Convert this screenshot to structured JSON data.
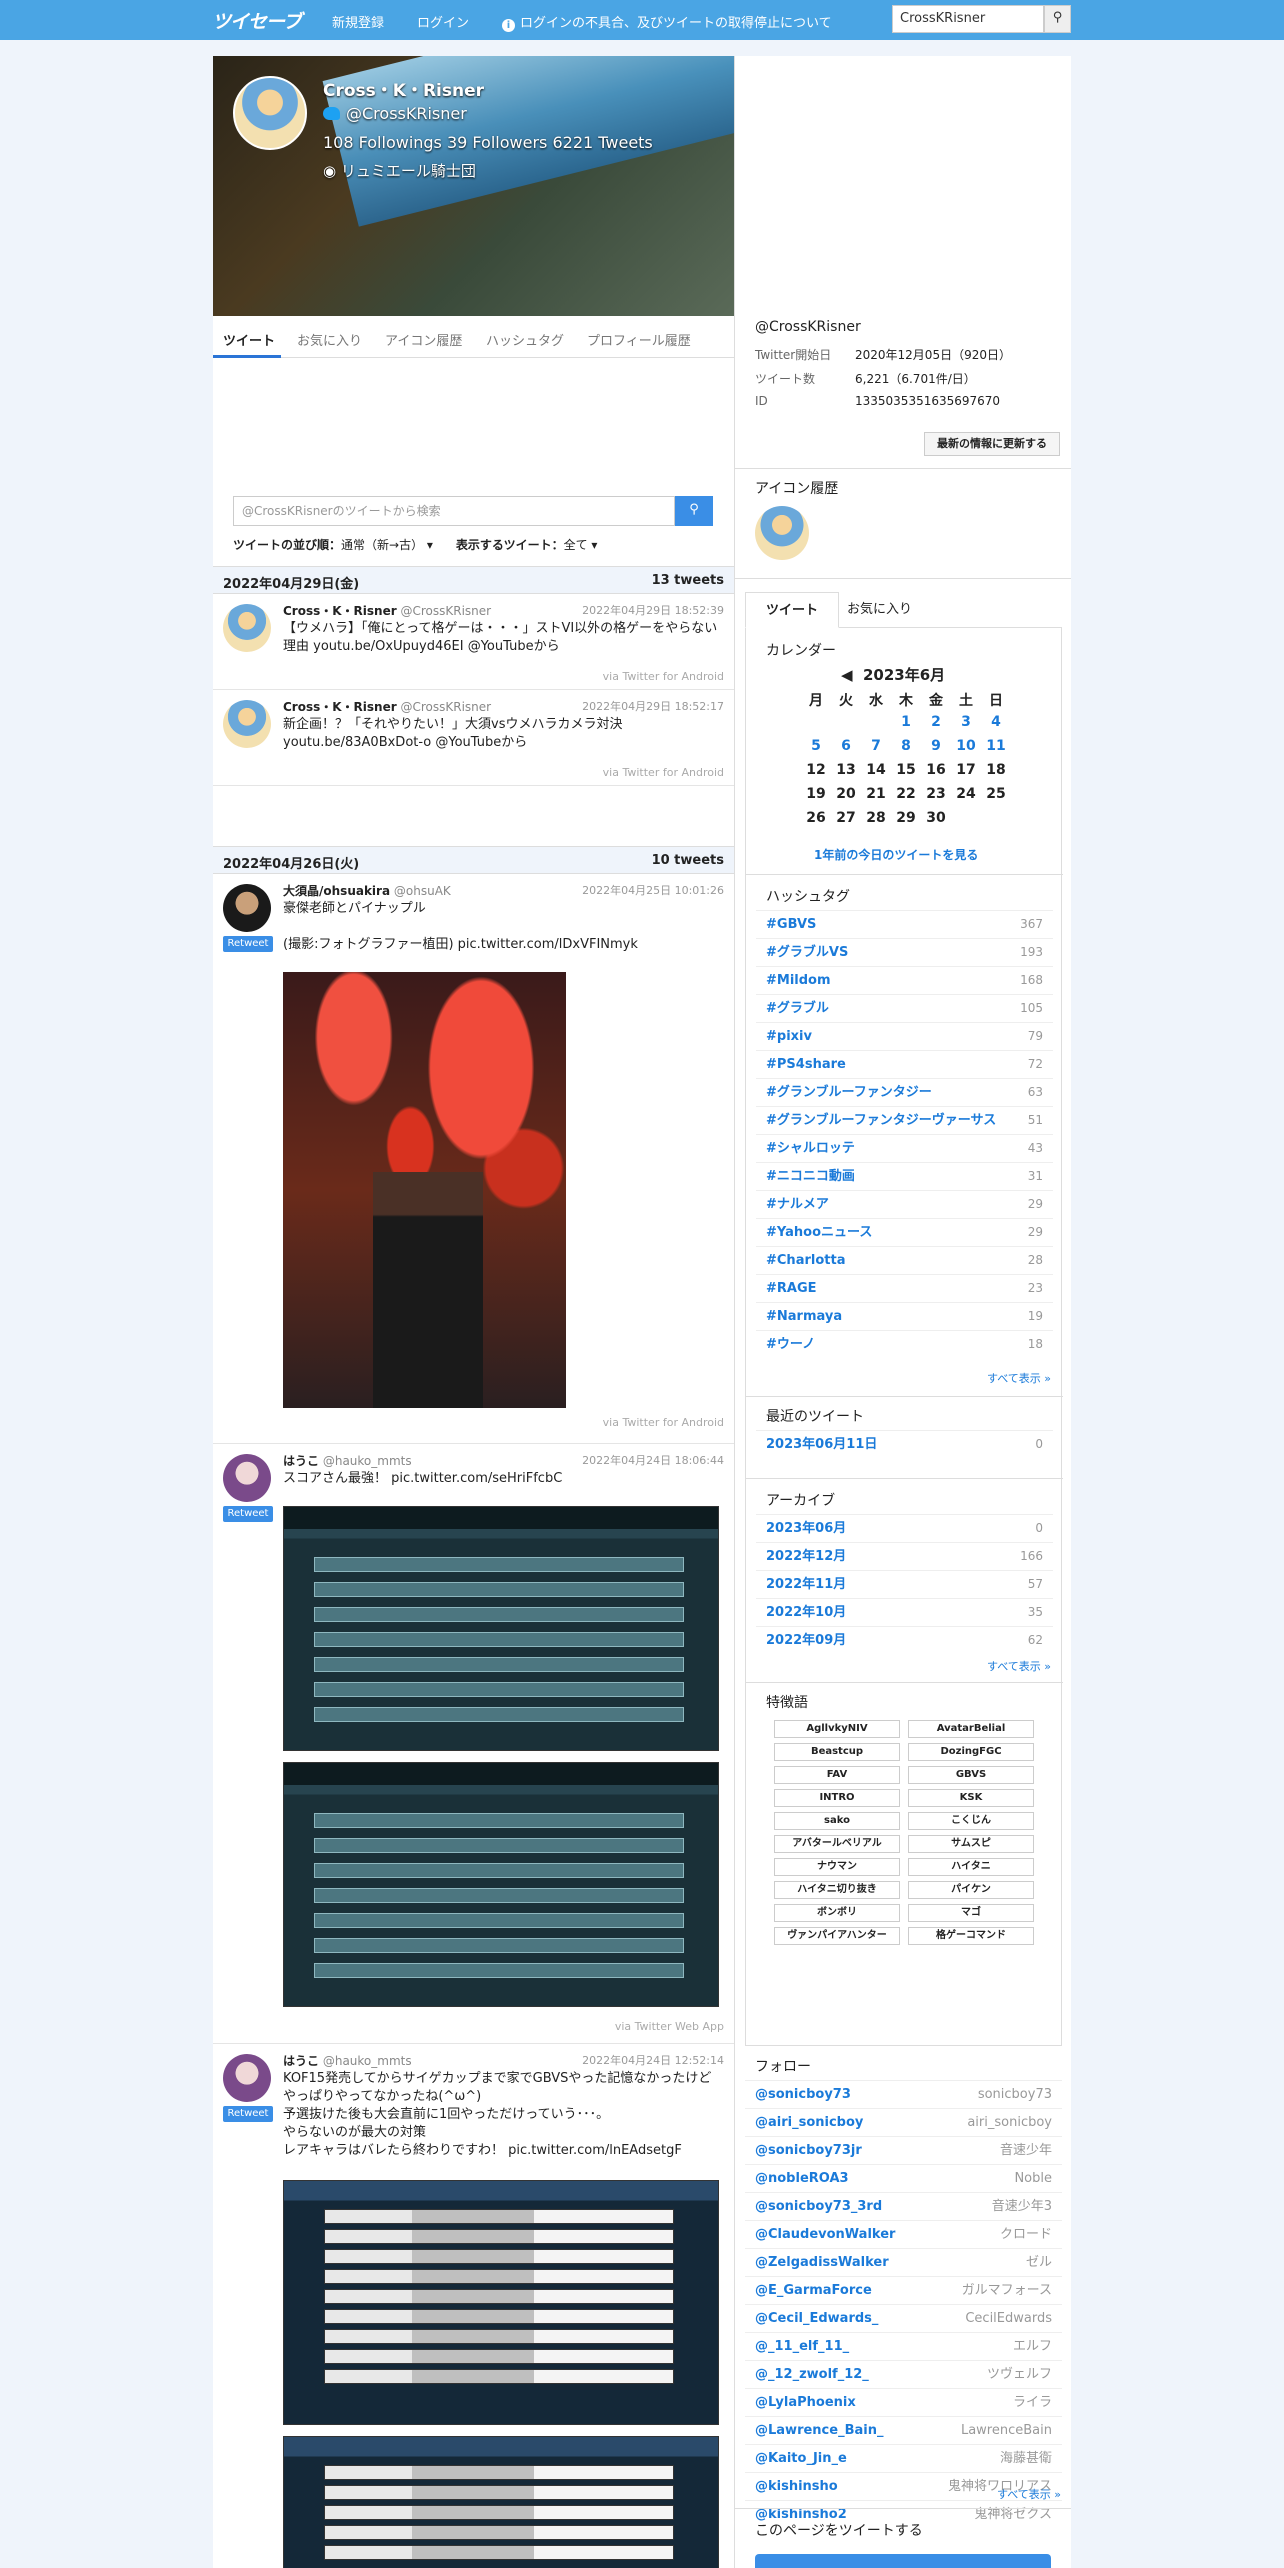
{
  "header": {
    "logo": "ツイセーブ",
    "nav": [
      "新規登録",
      "ログイン"
    ],
    "notice": "ログインの不具合、及びツイートの取得停止について",
    "search_value": "CrossKRisner"
  },
  "profile": {
    "name": "Cross・K・Risner",
    "handle": "@CrossKRisner",
    "stats": "108 Followings  39 Followers  6221 Tweets",
    "location": "リュミエール騎士団"
  },
  "tabs": [
    "ツイート",
    "お気に入り",
    "アイコン履歴",
    "ハッシュタグ",
    "プロフィール履歴"
  ],
  "tweet_search": {
    "placeholder": "@CrossKRisnerのツイートから検索"
  },
  "sort": {
    "order_label": "ツイートの並び順：",
    "order_value": "通常（新→古）",
    "show_label": "表示するツイート：",
    "show_value": "全て"
  },
  "days": [
    {
      "date": "2022年04月29日(金)",
      "count": "13 tweets"
    },
    {
      "date": "2022年04月26日(火)",
      "count": "10 tweets"
    }
  ],
  "tweets": [
    {
      "name": "Cross・K・Risner",
      "handle": "@CrossKRisner",
      "time": "2022年04月29日 18:52:39",
      "text": "【ウメハラ】「俺にとって格ゲーは・・・」ストVI以外の格ゲーをやらない理由 youtu.be/OxUpuyd46EI @YouTubeから",
      "via": "via Twitter for Android"
    },
    {
      "name": "Cross・K・Risner",
      "handle": "@CrossKRisner",
      "time": "2022年04月29日 18:52:17",
      "text": "新企画！？「それやりたい！」大須vsウメハラカメラ対決 youtu.be/83A0BxDot-o @YouTubeから",
      "via": "via Twitter for Android"
    },
    {
      "name": "大須晶/ohsuakira",
      "handle": "@ohsuAK",
      "time": "2022年04月25日 10:01:26",
      "text": "豪傑老師とパイナップル\n\n(撮影:フォトグラファー植田) pic.twitter.com/lDxVFINmyk",
      "via": "via Twitter for Android",
      "rt": "Retweet"
    },
    {
      "name": "はうこ",
      "handle": "@hauko_mmts",
      "time": "2022年04月24日 18:06:44",
      "text": "スコアさん最強！ pic.twitter.com/seHriFfcbC",
      "via": "via Twitter Web App",
      "rt": "Retweet"
    },
    {
      "name": "はうこ",
      "handle": "@hauko_mmts",
      "time": "2022年04月24日 12:52:14",
      "text": "KOF15発売してからサイゲカップまで家でGBVSやった記憶なかったけどやっぱりやってなかったね(^ω^)\n予選抜けた後も大会直前に1回やっただけっていう･･･。\nやらないのが最大の対策\nレアキャラはバレたら終わりですわ！ pic.twitter.com/lnEAdsetgF",
      "rt": "Retweet"
    }
  ],
  "side": {
    "handle": "@CrossKRisner",
    "info": [
      {
        "k": "Twitter開始日",
        "v": "2020年12月05日（920日）"
      },
      {
        "k": "ツイート数",
        "v": "6,221（6.701件/日）"
      },
      {
        "k": "ID",
        "v": "1335035351635697670"
      }
    ],
    "update_btn": "最新の情報に更新する",
    "icon_history": "アイコン履歴",
    "tabs": [
      "ツイート",
      "お気に入り"
    ],
    "calendar_title": "カレンダー",
    "month": "2023年6月",
    "weekdays": [
      "月",
      "火",
      "水",
      "木",
      "金",
      "土",
      "日"
    ],
    "prev_year_link": "1年前の今日のツイートを見る",
    "hashtag_title": "ハッシュタグ",
    "hashtags": [
      {
        "tag": "#GBVS",
        "n": "367"
      },
      {
        "tag": "#グラブルVS",
        "n": "193"
      },
      {
        "tag": "#Mildom",
        "n": "168"
      },
      {
        "tag": "#グラブル",
        "n": "105"
      },
      {
        "tag": "#pixiv",
        "n": "79"
      },
      {
        "tag": "#PS4share",
        "n": "72"
      },
      {
        "tag": "#グランブルーファンタジー",
        "n": "63"
      },
      {
        "tag": "#グランブルーファンタジーヴァーサス",
        "n": "51"
      },
      {
        "tag": "#シャルロッテ",
        "n": "43"
      },
      {
        "tag": "#ニコニコ動画",
        "n": "31"
      },
      {
        "tag": "#ナルメア",
        "n": "29"
      },
      {
        "tag": "#Yahooニュース",
        "n": "29"
      },
      {
        "tag": "#Charlotta",
        "n": "28"
      },
      {
        "tag": "#RAGE",
        "n": "23"
      },
      {
        "tag": "#Narmaya",
        "n": "19"
      },
      {
        "tag": "#ウーノ",
        "n": "18"
      }
    ],
    "show_all": "すべて表示 »",
    "recent_title": "最近のツイート",
    "recent": [
      {
        "d": "2023年06月11日",
        "n": "0"
      }
    ],
    "archive_title": "アーカイブ",
    "archive": [
      {
        "d": "2023年06月",
        "n": "0"
      },
      {
        "d": "2022年12月",
        "n": "166"
      },
      {
        "d": "2022年11月",
        "n": "57"
      },
      {
        "d": "2022年10月",
        "n": "35"
      },
      {
        "d": "2022年09月",
        "n": "62"
      }
    ],
    "keyword_title": "特徴語",
    "keywords": [
      "AgllvkyNIV",
      "AvatarBelial",
      "Beastcup",
      "DozingFGC",
      "FAV",
      "GBVS",
      "INTRO",
      "KSK",
      "sako",
      "こくじん",
      "アバタールベリアル",
      "サムスピ",
      "ナウマン",
      "ハイタニ",
      "ハイタニ切り抜き",
      "パイケン",
      "ボンボリ",
      "マゴ",
      "ヴァンパイアハンター",
      "格ゲーコマンド"
    ],
    "follow_title": "フォロー",
    "follows": [
      {
        "h": "@sonicboy73",
        "n": "sonicboy73"
      },
      {
        "h": "@airi_sonicboy",
        "n": "airi_sonicboy"
      },
      {
        "h": "@sonicboy73jr",
        "n": "音速少年"
      },
      {
        "h": "@nobleROA3",
        "n": "Noble"
      },
      {
        "h": "@sonicboy73_3rd",
        "n": "音速少年3"
      },
      {
        "h": "@ClaudevonWalker",
        "n": "クロード"
      },
      {
        "h": "@ZelgadissWalker",
        "n": "ゼル"
      },
      {
        "h": "@E_GarmaForce",
        "n": "ガルマフォース"
      },
      {
        "h": "@Cecil_Edwards_",
        "n": "CecilEdwards"
      },
      {
        "h": "@_11_elf_11_",
        "n": "エルフ"
      },
      {
        "h": "@_12_zwolf_12_",
        "n": "ツヴェルフ"
      },
      {
        "h": "@LylaPhoenix",
        "n": "ライラ"
      },
      {
        "h": "@Lawrence_Bain_",
        "n": "LawrenceBain"
      },
      {
        "h": "@Kaito_Jin_e",
        "n": "海藤甚衛"
      },
      {
        "h": "@kishinsho",
        "n": "鬼神将ワロリアス"
      },
      {
        "h": "@kishinsho2",
        "n": "鬼神将ゼクス"
      }
    ],
    "share_title": "このページをツイートする"
  },
  "colors": {
    "header": "#4aa5e4",
    "link": "#1a7ad9",
    "button": "#3a8ee6"
  }
}
